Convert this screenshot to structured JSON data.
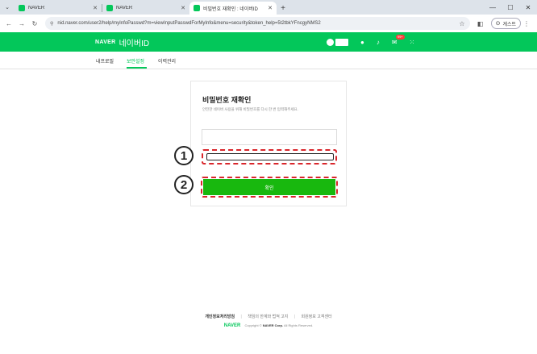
{
  "browser": {
    "tabs": [
      {
        "title": "NAVER",
        "active": false
      },
      {
        "title": "NAVER",
        "active": false
      },
      {
        "title": "비밀번호 재확인 : 네이버ID",
        "active": true
      }
    ],
    "new_tab": "+",
    "url": "nid.naver.com/user2/help/myInfoPasswd?m=viewInputPasswdForMyInfo&menu=security&token_help=5t2tbkYFncgyNMS2",
    "profile_label": "게스트"
  },
  "header": {
    "logo": "NAVER",
    "title": "네이버ID",
    "mail_badge": "99+"
  },
  "subnav": {
    "items": [
      "내프로필",
      "보안설정",
      "이력관리"
    ],
    "active_index": 1
  },
  "form": {
    "heading": "비밀번호 재확인",
    "description": "안전한 네이버 사용을 위해 비밀번호를 다시 한 번 입력해주세요.",
    "id_value": "",
    "password_value": "",
    "confirm_label": "확인"
  },
  "markers": {
    "step1": "1",
    "step2": "2"
  },
  "footer": {
    "links": [
      "개인정보처리방침",
      "책임의 한계와 법적 고지",
      "회원정보 고객센터"
    ],
    "copyright_prefix": "Copyright ©",
    "company": "NAVER Corp.",
    "rights": "All Rights Reserved.",
    "logo": "NAVER"
  },
  "colors": {
    "brand": "#03c75a",
    "confirm_button": "#18b80e",
    "highlight": "#d9262b"
  }
}
